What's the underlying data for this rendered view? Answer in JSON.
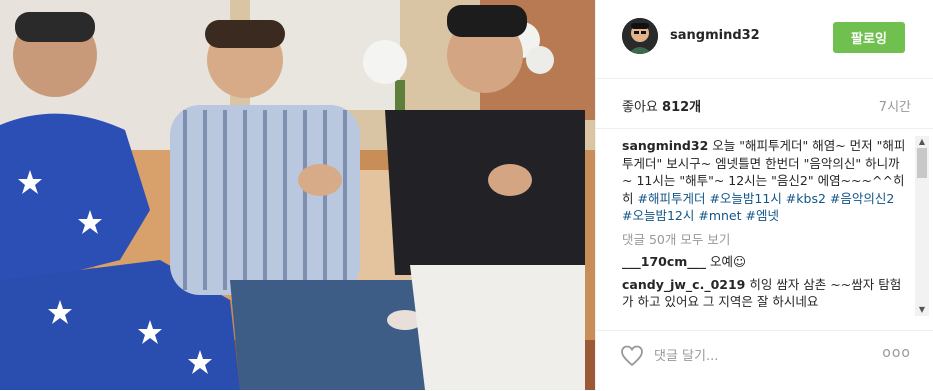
{
  "header": {
    "username": "sangmind32",
    "follow_label": "팔로잉"
  },
  "meta": {
    "likes_label": "좋아요",
    "likes_count": "812개",
    "time": "7시간"
  },
  "caption": {
    "username": "sangmind32",
    "text": "오늘 \"해피투게더\" 해염~ 먼저 \"해피투게더\" 보시구~ 엠넷틀면 한번더 \"음악의신\" 하니까~ 11시는 \"해투\"~ 12시는 \"음신2\" 에염~~~^^히히",
    "hashtags": "#해피투게더 #오늘밤11시 #kbs2 #음악의신2 #오늘밤12시 #mnet #엠넷"
  },
  "view_all": "댓글 50개 모두 보기",
  "comments": [
    {
      "username": "___170cm___",
      "text": "오예☺"
    },
    {
      "username": "candy_jw_c._0219",
      "text": "히잉 쌈자 삼촌 ~~쌈자 탐험가 하고 있어요 그 지역은 잘 하시네요"
    }
  ],
  "footer": {
    "comment_placeholder": "댓글 달기...",
    "more_label": "ooo"
  },
  "colors": {
    "follow_button": "#70c050",
    "hashtag": "#125688",
    "muted": "#999999"
  },
  "icons": [
    "heart-icon",
    "more-options-icon",
    "scroll-up-icon",
    "scroll-down-icon"
  ]
}
